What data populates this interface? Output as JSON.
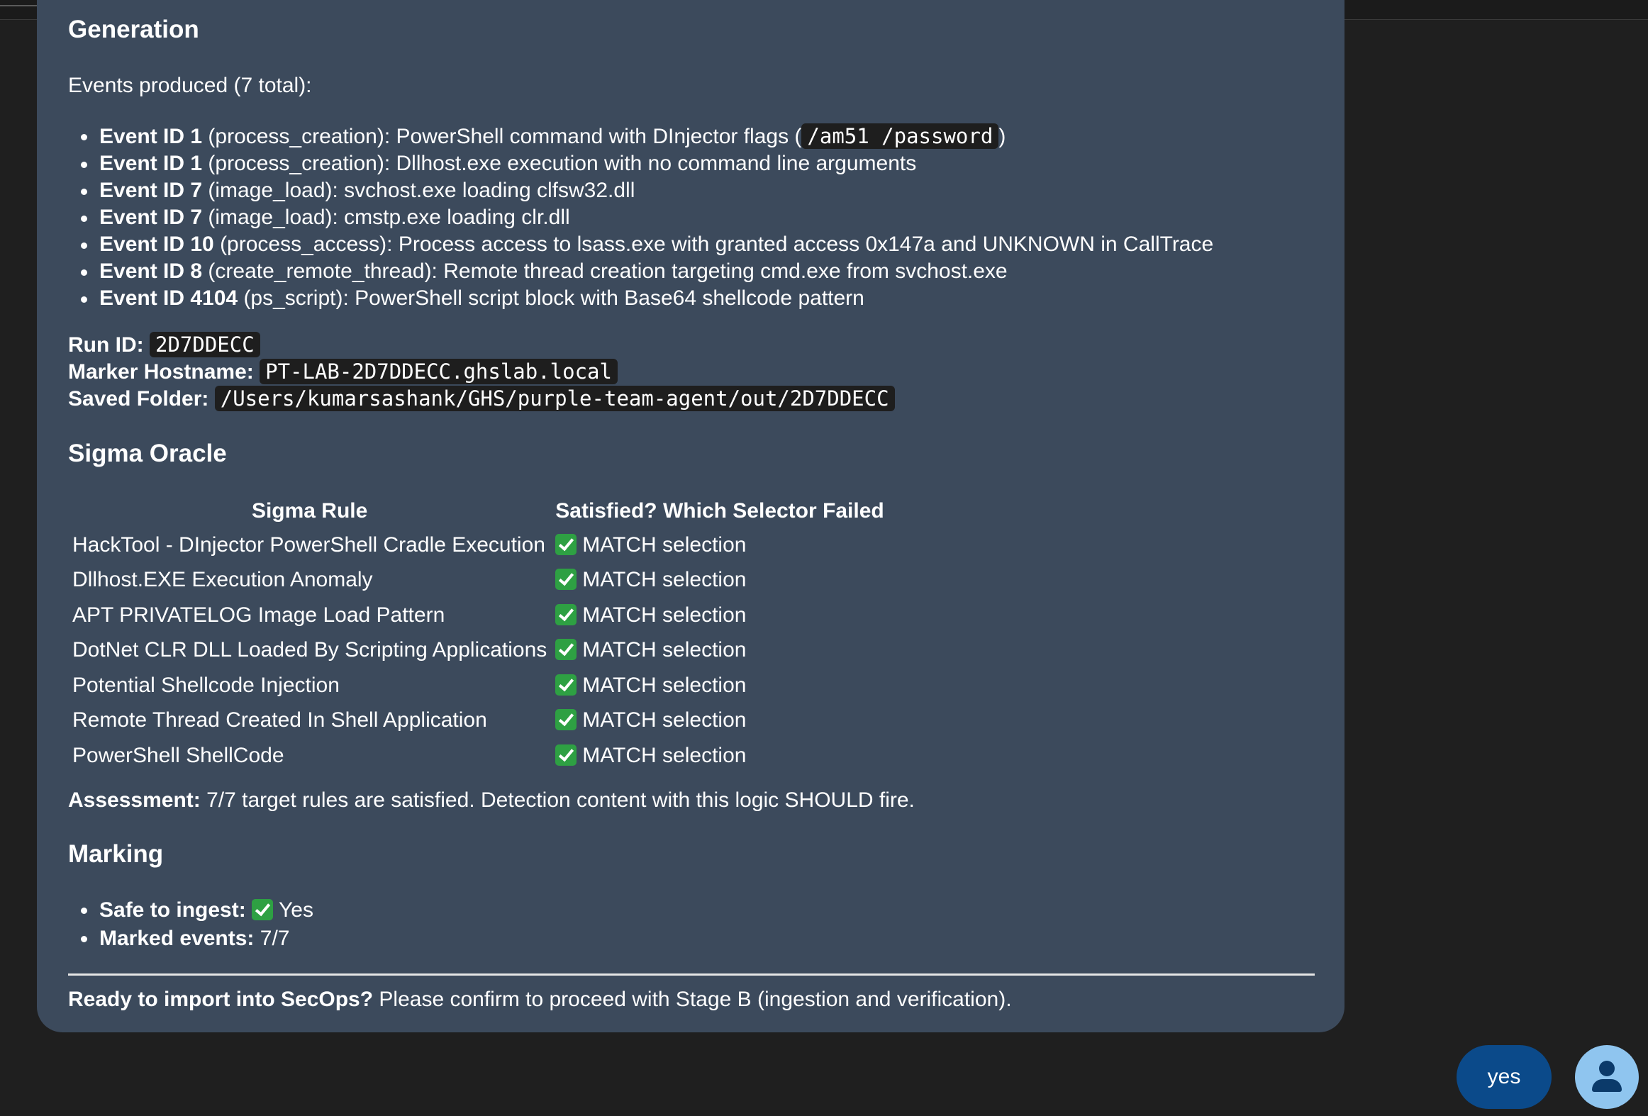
{
  "generation": {
    "heading": "Generation",
    "summary": "Events produced (7 total):",
    "events": [
      {
        "id": "Event ID 1",
        "rest": " (process_creation): PowerShell command with DInjector flags (",
        "code": "/am51 /password",
        "tail": ")"
      },
      {
        "id": "Event ID 1",
        "rest": " (process_creation): Dllhost.exe execution with no command line arguments",
        "code": "",
        "tail": ""
      },
      {
        "id": "Event ID 7",
        "rest": " (image_load): svchost.exe loading clfsw32.dll",
        "code": "",
        "tail": ""
      },
      {
        "id": "Event ID 7",
        "rest": " (image_load): cmstp.exe loading clr.dll",
        "code": "",
        "tail": ""
      },
      {
        "id": "Event ID 10",
        "rest": " (process_access): Process access to lsass.exe with granted access 0x147a and UNKNOWN in CallTrace",
        "code": "",
        "tail": ""
      },
      {
        "id": "Event ID 8",
        "rest": " (create_remote_thread): Remote thread creation targeting cmd.exe from svchost.exe",
        "code": "",
        "tail": ""
      },
      {
        "id": "Event ID 4104",
        "rest": " (ps_script): PowerShell script block with Base64 shellcode pattern",
        "code": "",
        "tail": ""
      }
    ],
    "run_id_label": "Run ID:",
    "run_id": "2D7DDECC",
    "hostname_label": "Marker Hostname:",
    "hostname": "PT-LAB-2D7DDECC.ghslab.local",
    "folder_label": "Saved Folder:",
    "folder": "/Users/kumarsashank/GHS/purple-team-agent/out/2D7DDECC"
  },
  "sigma": {
    "heading": "Sigma Oracle",
    "col_rule": "Sigma Rule",
    "col_status": "Satisfied? Which Selector Failed",
    "rows": [
      {
        "rule": "HackTool - DInjector PowerShell Cradle Execution",
        "status": "MATCH selection"
      },
      {
        "rule": "Dllhost.EXE Execution Anomaly",
        "status": "MATCH selection"
      },
      {
        "rule": "APT PRIVATELOG Image Load Pattern",
        "status": "MATCH selection"
      },
      {
        "rule": "DotNet CLR DLL Loaded By Scripting Applications",
        "status": "MATCH selection"
      },
      {
        "rule": "Potential Shellcode Injection",
        "status": "MATCH selection"
      },
      {
        "rule": "Remote Thread Created In Shell Application",
        "status": "MATCH selection"
      },
      {
        "rule": "PowerShell ShellCode",
        "status": "MATCH selection"
      }
    ],
    "assessment_label": "Assessment:",
    "assessment_text": " 7/7 target rules are satisfied. Detection content with this logic SHOULD fire."
  },
  "marking": {
    "heading": "Marking",
    "safe_label": "Safe to ingest:",
    "safe_value": "Yes",
    "marked_label": "Marked events:",
    "marked_value": " 7/7"
  },
  "footer": {
    "question_label": "Ready to import into SecOps?",
    "question_text": " Please confirm to proceed with Stage B (ingestion and verification)."
  },
  "chat": {
    "user_reply": "yes"
  },
  "colors": {
    "page_bg": "#1f1f1f",
    "card_bg": "#3c4a5c",
    "code_bg": "#1e1e1e",
    "check_green": "#2ea043",
    "reply_bubble": "#0b4a8a",
    "avatar_bg": "#8fc5ef"
  },
  "icons": [
    "check-mark-icon",
    "user-icon"
  ]
}
